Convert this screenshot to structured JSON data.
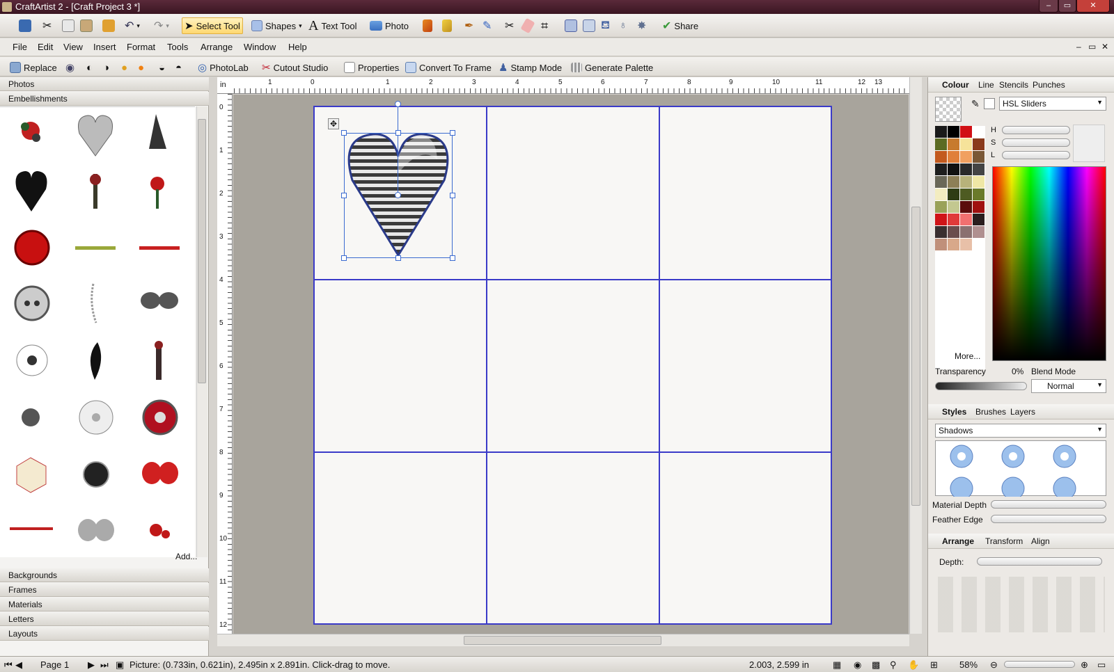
{
  "window": {
    "title": "CraftArtist 2 - [Craft Project 3 *]",
    "min": "–",
    "max": "▭",
    "close": "✕"
  },
  "toolbar": {
    "select_tool": "Select Tool",
    "shapes": "Shapes",
    "text_tool": "Text Tool",
    "photo": "Photo",
    "share": "Share"
  },
  "menu": [
    "File",
    "Edit",
    "View",
    "Insert",
    "Format",
    "Tools",
    "Arrange",
    "Window",
    "Help"
  ],
  "context_bar": {
    "replace": "Replace",
    "photolab": "PhotoLab",
    "cutout_studio": "Cutout Studio",
    "properties": "Properties",
    "convert_to_frame": "Convert To Frame",
    "stamp_mode": "Stamp Mode",
    "generate_palette": "Generate Palette"
  },
  "left_panel": {
    "photos": "Photos",
    "embellishments": "Embellishments",
    "add": "Add...",
    "sections": [
      "Backgrounds",
      "Frames",
      "Materials",
      "Letters",
      "Layouts"
    ]
  },
  "ruler": {
    "unit": "in",
    "h_ticks": [
      "1",
      "0",
      "1",
      "2",
      "3",
      "4",
      "5",
      "6",
      "7",
      "8",
      "9",
      "10",
      "11",
      "12",
      "13"
    ],
    "v_ticks": [
      "0",
      "1",
      "2",
      "3",
      "4",
      "5",
      "6",
      "7",
      "8",
      "9",
      "10",
      "11",
      "12"
    ]
  },
  "colour_panel": {
    "tabs": [
      "Colour",
      "Line",
      "Stencils",
      "Punches"
    ],
    "mode": "HSL Sliders",
    "h": "H",
    "s": "S",
    "l": "L",
    "more": "More...",
    "transparency_label": "Transparency",
    "transparency_value": "0%",
    "blend_label": "Blend Mode",
    "blend_value": "Normal",
    "swatches": [
      "#1a1a1a",
      "#000000",
      "#d10f14",
      "#ffffff",
      "#5c6b23",
      "#c77a2e",
      "#f6e39a",
      "#8a3a1c",
      "#c35a1e",
      "#e07f3a",
      "#f1a060",
      "#7a5836",
      "#1e1e1e",
      "#111111",
      "#2a2a2a",
      "#444444",
      "#6a6858",
      "#8d7f57",
      "#b7b27a",
      "#efe7a5",
      "#f3ecc0",
      "#2f3c14",
      "#4e5b22",
      "#6a7a2a",
      "#9aa25a",
      "#c3c890",
      "#5a0c0c",
      "#a01010",
      "#d01418",
      "#e03a3a",
      "#f07070",
      "#2a1e1e",
      "#3a2f2f",
      "#6a4d4d",
      "#8a7070",
      "#b09090",
      "#c0907a",
      "#d8a88a",
      "#e8c0a8",
      "#ffffff"
    ]
  },
  "styles_panel": {
    "tabs": [
      "Styles",
      "Brushes",
      "Layers"
    ],
    "category": "Shadows",
    "material_depth": "Material Depth",
    "feather_edge": "Feather Edge"
  },
  "arrange_panel": {
    "tabs": [
      "Arrange",
      "Transform",
      "Align"
    ],
    "depth": "Depth:"
  },
  "status": {
    "page": "Page 1",
    "info": "Picture: (0.733in, 0.621in), 2.495in x 2.891in. Click-drag to move.",
    "coords": "2.003,  2.599 in",
    "zoom": "58%"
  }
}
